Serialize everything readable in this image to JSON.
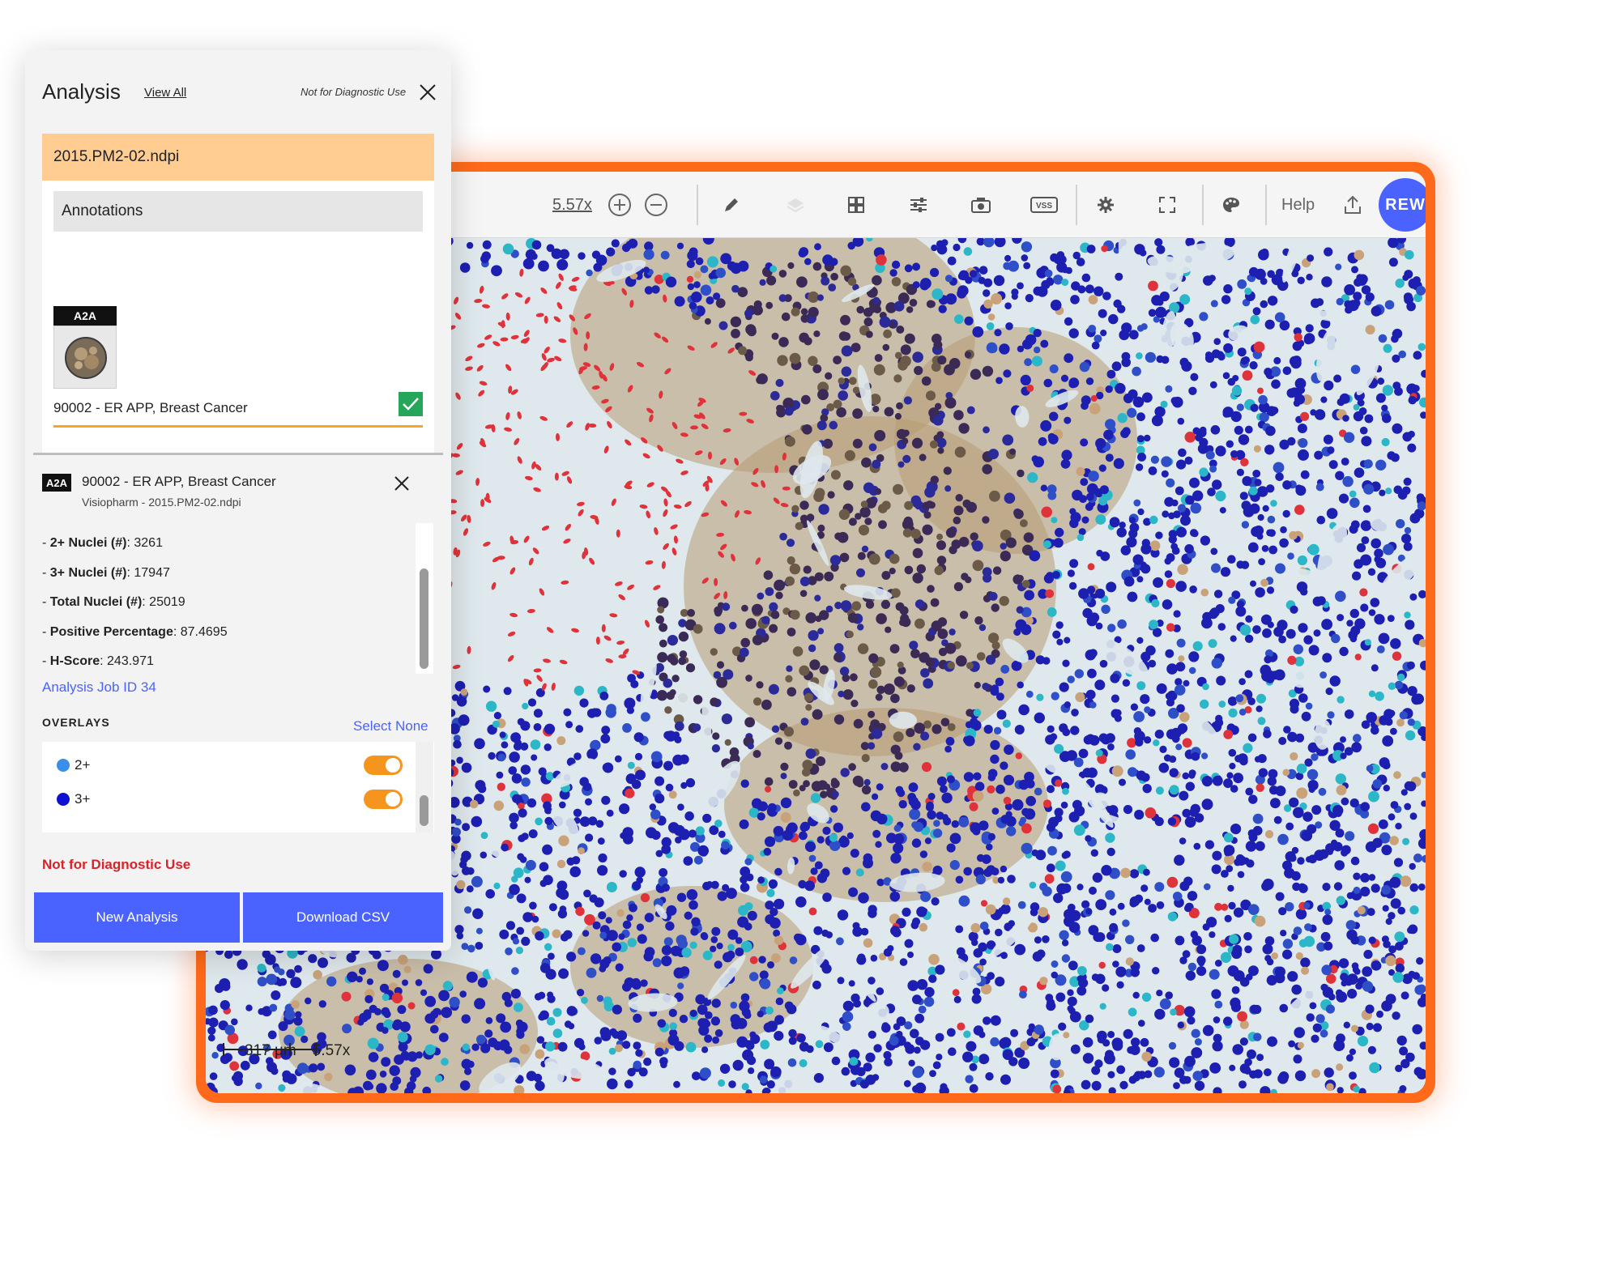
{
  "viewer": {
    "zoom": "5.57x",
    "help_label": "Help",
    "user_initials": "REW",
    "toolbar_icons": [
      "zoom-in-icon",
      "zoom-out-icon",
      "pencil-icon",
      "layers-icon",
      "grid-icon",
      "sliders-icon",
      "camera-icon",
      "vss-icon",
      "gear-icon",
      "fullscreen-icon",
      "palette-icon",
      "upload-icon"
    ],
    "vss_label": "VSS",
    "scale_length": "317 µm",
    "scale_zoom": "5.57x",
    "accent": "#ff6a1a"
  },
  "panel": {
    "title": "Analysis",
    "view_all": "View All",
    "disclaimer_top": "Not for Diagnostic Use",
    "file_name": "2015.PM2-02.ndpi",
    "annotations_header": "Annotations",
    "annotation": {
      "tag": "A2A",
      "name": "90002 - ER APP, Breast Cancer",
      "checked": true
    },
    "detail": {
      "tag": "A2A",
      "title": "90002 - ER APP, Breast Cancer",
      "subtitle": "Visiopharm - 2015.PM2-02.ndpi",
      "metrics": [
        {
          "label": "2+ Nuclei (#)",
          "value": "3261"
        },
        {
          "label": "3+ Nuclei (#)",
          "value": "17947"
        },
        {
          "label": "Total Nuclei (#)",
          "value": "25019"
        },
        {
          "label": "Positive Percentage",
          "value": "87.4695"
        },
        {
          "label": "H-Score",
          "value": "243.971"
        }
      ],
      "job_link": "Analysis Job ID 34"
    },
    "overlays_label": "OVERLAYS",
    "select_none": "Select None",
    "overlays": [
      {
        "label": "2+",
        "color": "#3a8ee6",
        "on": true
      },
      {
        "label": "3+",
        "color": "#1010d0",
        "on": true
      }
    ],
    "disclaimer_bottom": "Not for Diagnostic Use",
    "new_analysis": "New Analysis",
    "download_csv": "Download CSV",
    "button_color": "#4a63ff"
  }
}
